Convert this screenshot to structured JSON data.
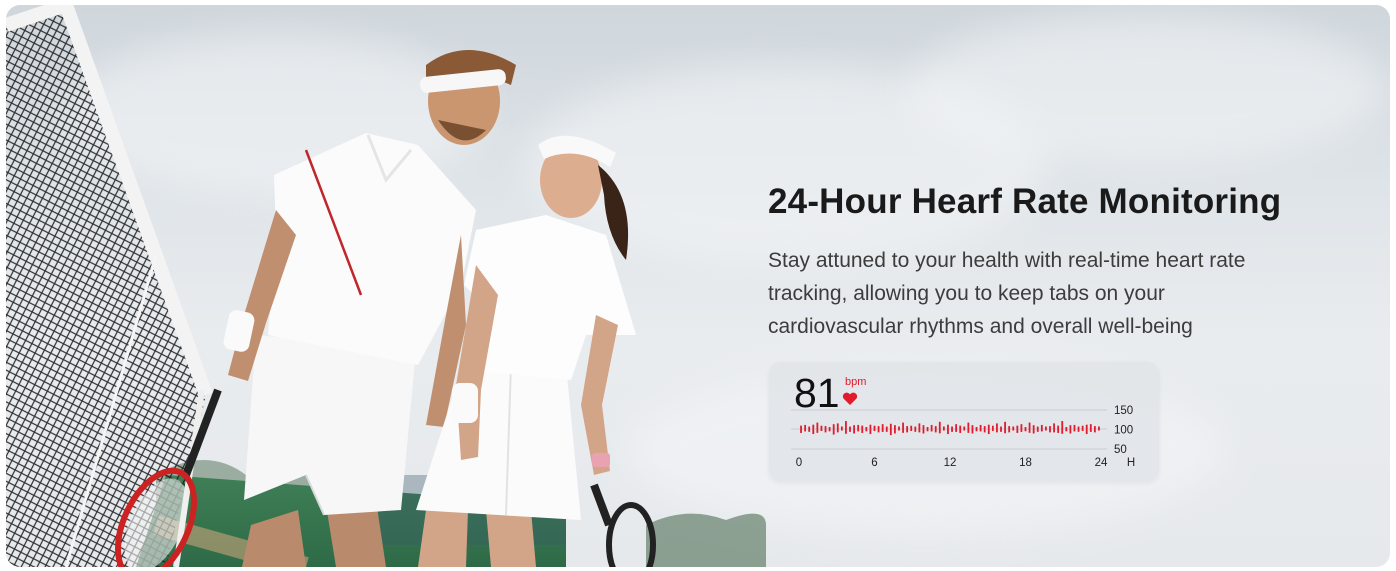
{
  "headline": "24-Hour Hearf Rate Monitoring",
  "description": "Stay attuned to your health with real-time heart rate tracking, allowing you to keep tabs on your cardiovascular rhythms and overall well-being",
  "widget": {
    "bpm_value": "81",
    "bpm_unit": "bpm",
    "y_ticks": [
      "150",
      "100",
      "50"
    ],
    "x_ticks": [
      "0",
      "6",
      "12",
      "18",
      "24"
    ],
    "x_unit": "H",
    "accent_color": "#e11b2c"
  },
  "chart_data": {
    "type": "bar",
    "ylim": [
      50,
      150
    ],
    "xlim": [
      0,
      24
    ],
    "series": [
      {
        "values": [
          92,
          104,
          96,
          88,
          110,
          102,
          94,
          98,
          86,
          108,
          100,
          114,
          96,
          90,
          104,
          92,
          98,
          88,
          102,
          94,
          106,
          96,
          84,
          90,
          100,
          110,
          94,
          102,
          96,
          108,
          90,
          98,
          104,
          94,
          112,
          100,
          88,
          96,
          106,
          92,
          100,
          110,
          90,
          98,
          104,
          94,
          88,
          102,
          108,
          96,
          112,
          94,
          100,
          92,
          106,
          98,
          110,
          90,
          96,
          104,
          100,
          94,
          108,
          92,
          114,
          98,
          90,
          104,
          96,
          102,
          88,
          106,
          94,
          100
        ]
      }
    ]
  }
}
